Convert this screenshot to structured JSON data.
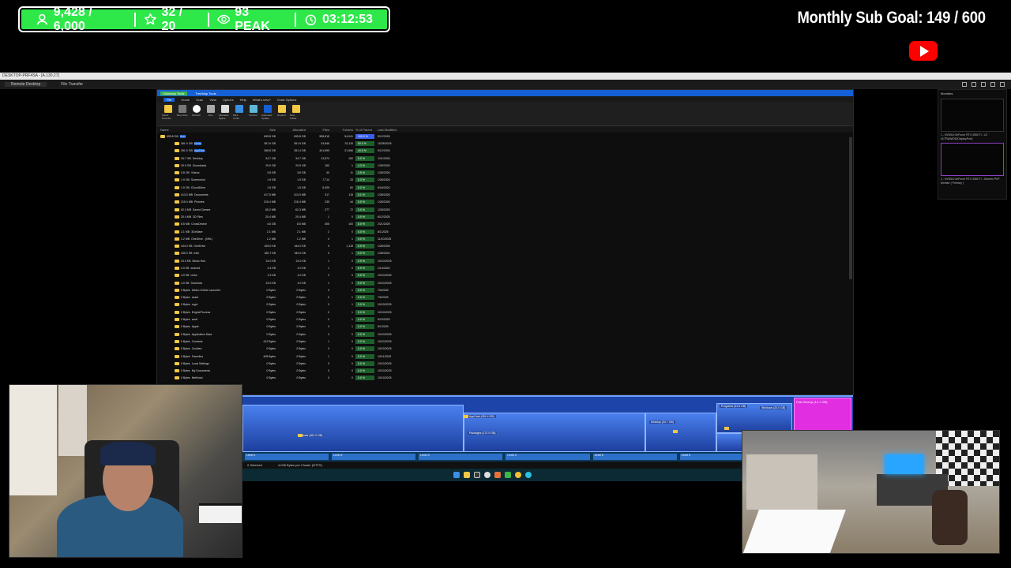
{
  "overlay": {
    "stats": [
      {
        "icon": "person-icon",
        "text": "9,428 / 6,000"
      },
      {
        "icon": "star-icon",
        "text": "32 / 20"
      },
      {
        "icon": "eye-icon",
        "text": "93 PEAK"
      },
      {
        "icon": "timer-icon",
        "text": "03:12:53"
      }
    ],
    "sub_goal": "Monthly Sub Goal:  149 / 600",
    "accent": "#2ee84a"
  },
  "remote_desktop": {
    "title": "DESKTOP-PRF4SA - [A.130.27]",
    "tabs": [
      "Remote Desktop",
      "File Transfer"
    ]
  },
  "app": {
    "title_tabs": [
      "Directory Tools",
      "TreeMap Tools"
    ],
    "ribbon_tabs": [
      "File",
      "Home",
      "Scan",
      "View",
      "Options",
      "Help",
      "What's new?",
      "Chart Options"
    ],
    "ribbon_buttons": [
      "Select Drive/Dir",
      "Stop Scan",
      "Refresh",
      "Size",
      "Allocated Space",
      "Files Count",
      "Percent",
      "Automatic Update",
      "Expand",
      "New Folder"
    ],
    "ribbon_groups": [
      "Scan",
      "Mode",
      "View",
      "Folder Operations"
    ],
    "columns": [
      "Name",
      "Size",
      "Allocated",
      "Files",
      "Folders",
      "% of Parent",
      "Last Modified"
    ],
    "rows": [
      {
        "size_tag": "695.8 GB",
        "name": "User",
        "size": "695.8 GB",
        "alloc": "695.8 GB",
        "files": "508,815",
        "folders": "54,041",
        "pct": "100.0 %",
        "date": "9/12/2026"
      },
      {
        "size_tag": "361.9 GB",
        "name": "Movie",
        "size": "361.9 GB",
        "alloc": "361.9 GB",
        "files": "34,846",
        "folders": "32,116",
        "pct": "52.0 %",
        "date": "10/28/2026"
      },
      {
        "size_tag": "281.5 GB",
        "name": "AppData",
        "size": "268.8 GB",
        "alloc": "281.4 GB",
        "files": "441,899",
        "folders": "21,566",
        "pct": "40.5 %",
        "date": "9/12/2026"
      },
      {
        "size_tag": "34.7 GB",
        "name": "Desktop",
        "size": "34.7 GB",
        "alloc": "34.7 GB",
        "files": "12,874",
        "folders": "150",
        "pct": "5.0 %",
        "date": "1/31/2026"
      },
      {
        "size_tag": "29.9 GB",
        "name": "Downloads",
        "size": "29.9 GB",
        "alloc": "29.9 GB",
        "files": "160",
        "folders": "1",
        "pct": "4.3 %",
        "date": "1/28/2026"
      },
      {
        "size_tag": "3.8 GB",
        "name": "Videos",
        "size": "3.8 GB",
        "alloc": "3.8 GB",
        "files": "40",
        "folders": "11",
        "pct": "0.5 %",
        "date": "1/28/2026"
      },
      {
        "size_tag": "1.9 GB",
        "name": "Screenshot",
        "size": "1.9 GB",
        "alloc": "1.9 GB",
        "files": "7,714",
        "folders": "33",
        "pct": "0.3 %",
        "date": "1/28/2026"
      },
      {
        "size_tag": "1.5 GB",
        "name": "iCloudDrive",
        "size": "1.5 GB",
        "alloc": "1.5 GB",
        "files": "5,309",
        "folders": "60",
        "pct": "0.2 %",
        "date": "6/16/2024"
      },
      {
        "size_tag": "413.0 MB",
        "name": "Documents",
        "size": "417.5 MB",
        "alloc": "413.0 MB",
        "files": "317",
        "folders": "115",
        "pct": "0.1 %",
        "date": "1/28/2026"
      },
      {
        "size_tag": "215.4 MB",
        "name": "Pictures",
        "size": "215.4 MB",
        "alloc": "215.4 MB",
        "files": "235",
        "folders": "44",
        "pct": "0.0 %",
        "date": "1/28/2026"
      },
      {
        "size_tag": "62.3 MB",
        "name": "Saved Games",
        "size": "65.2 MB",
        "alloc": "62.3 MB",
        "files": "277",
        "folders": "72",
        "pct": "0.0 %",
        "date": "12/8/2025"
      },
      {
        "size_tag": "20.4 MB",
        "name": "3D Files",
        "size": "20.4 MB",
        "alloc": "20.4 MB",
        "files": "1",
        "folders": "0",
        "pct": "0.0 %",
        "date": "6/12/2025"
      },
      {
        "size_tag": "8.5 MB",
        "name": "CrossDevice",
        "size": "4.6 GB",
        "alloc": "8.5 MB",
        "files": "305",
        "folders": "100",
        "pct": "0.0 %",
        "date": "2/21/2025"
      },
      {
        "size_tag": "2.1 MB",
        "name": "3DxWare",
        "size": "2.1 MB",
        "alloc": "2.1 MB",
        "files": "2",
        "folders": "0",
        "pct": "0.0 %",
        "date": "8/1/2025"
      },
      {
        "size_tag": "1.2 MB",
        "name": "OneDrive - (NHL)",
        "size": "1.2 MB",
        "alloc": "1.2 MB",
        "files": "4",
        "folders": "1",
        "pct": "0.0 %",
        "date": "11/10/2025"
      },
      {
        "size_tag": "444.0 KB",
        "name": "OneDrive",
        "size": "425.0 KB",
        "alloc": "444.0 KB",
        "files": "9",
        "folders": "1,115",
        "pct": "0.0 %",
        "date": "1/28/2026"
      },
      {
        "size_tag": "340.0 KB",
        "name": "Intel",
        "size": "330.7 KB",
        "alloc": "340.0 KB",
        "files": "3",
        "folders": "1",
        "pct": "0.0 %",
        "date": "1/28/2024"
      },
      {
        "size_tag": "24.0 KB",
        "name": "Music Hub",
        "size": "24.0 KB",
        "alloc": "24.0 KB",
        "files": "1",
        "folders": "0",
        "pct": "0.0 %",
        "date": "10/10/2025"
      },
      {
        "size_tag": "4.0 KB",
        "name": "android",
        "size": "2.4 KB",
        "alloc": "4.0 KB",
        "files": "1",
        "folders": "0",
        "pct": "0.0 %",
        "date": "1/14/2024"
      },
      {
        "size_tag": "4.0 KB",
        "name": "Links",
        "size": "1.9 KB",
        "alloc": "4.0 KB",
        "files": "2",
        "folders": "0",
        "pct": "0.0 %",
        "date": "10/10/2025"
      },
      {
        "size_tag": "4.0 KB",
        "name": "Searches",
        "size": "24.0 KB",
        "alloc": "4.0 KB",
        "files": "1",
        "folders": "0",
        "pct": "0.0 %",
        "date": "10/10/2025"
      },
      {
        "size_tag": "0 Bytes",
        "name": "Albion Online Launcher",
        "size": "0 Bytes",
        "alloc": "0 Bytes",
        "files": "0",
        "folders": "1",
        "pct": "0.0 %",
        "date": "7/6/2025"
      },
      {
        "size_tag": "0 Bytes",
        "name": "ansel",
        "size": "0 Bytes",
        "alloc": "0 Bytes",
        "files": "0",
        "folders": "1",
        "pct": "0.0 %",
        "date": "7/6/2025"
      },
      {
        "size_tag": "0 Bytes",
        "name": "crypt",
        "size": "0 Bytes",
        "alloc": "0 Bytes",
        "files": "0",
        "folders": "1",
        "pct": "0.0 %",
        "date": "10/10/2025"
      },
      {
        "size_tag": "0 Bytes",
        "name": "EngineProcess",
        "size": "0 Bytes",
        "alloc": "0 Bytes",
        "files": "0",
        "folders": "1",
        "pct": "0.0 %",
        "date": "10/10/2025"
      },
      {
        "size_tag": "0 Bytes",
        "name": "anvil",
        "size": "0 Bytes",
        "alloc": "0 Bytes",
        "files": "0",
        "folders": "1",
        "pct": "0.0 %",
        "date": "5/15/2025"
      },
      {
        "size_tag": "0 Bytes",
        "name": "Apple",
        "size": "0 Bytes",
        "alloc": "0 Bytes",
        "files": "0",
        "folders": "1",
        "pct": "0.0 %",
        "date": "5/1/2025"
      },
      {
        "size_tag": "0 Bytes",
        "name": "Application Data",
        "size": "0 Bytes",
        "alloc": "0 Bytes",
        "files": "0",
        "folders": "0",
        "pct": "0.0 %",
        "date": "10/10/2025"
      },
      {
        "size_tag": "0 Bytes",
        "name": "Contacts",
        "size": "412 Bytes",
        "alloc": "0 Bytes",
        "files": "1",
        "folders": "0",
        "pct": "0.0 %",
        "date": "10/10/2025"
      },
      {
        "size_tag": "0 Bytes",
        "name": "Cookies",
        "size": "0 Bytes",
        "alloc": "0 Bytes",
        "files": "0",
        "folders": "0",
        "pct": "0.0 %",
        "date": "10/10/2025"
      },
      {
        "size_tag": "0 Bytes",
        "name": "Favorites",
        "size": "408 Bytes",
        "alloc": "0 Bytes",
        "files": "1",
        "folders": "0",
        "pct": "0.0 %",
        "date": "10/11/2025"
      },
      {
        "size_tag": "0 Bytes",
        "name": "Local Settings",
        "size": "0 Bytes",
        "alloc": "0 Bytes",
        "files": "0",
        "folders": "0",
        "pct": "0.0 %",
        "date": "10/10/2025"
      },
      {
        "size_tag": "0 Bytes",
        "name": "My Documents",
        "size": "0 Bytes",
        "alloc": "0 Bytes",
        "files": "0",
        "folders": "0",
        "pct": "0.0 %",
        "date": "10/10/2025"
      },
      {
        "size_tag": "0 Bytes",
        "name": "NetHood",
        "size": "0 Bytes",
        "alloc": "0 Bytes",
        "files": "0",
        "folders": "0",
        "pct": "0.0 %",
        "date": "10/10/2025"
      }
    ],
    "treemap_labels": [
      "AppData (281.4 GB)",
      "Movie (361.9 GB)",
      "Packages (172.0 GB)",
      "Desktop (34.7 GB)",
      "Programs (34.6 GB)",
      "Windows (20.0 GB)",
      "Fast Sweep (14.1 GB)"
    ],
    "status_segments": [
      "Level 1",
      "Level 2",
      "Level 3",
      "Level 4",
      "Level 5",
      "Level 6",
      "Level 7"
    ],
    "info": [
      "0 Selected",
      "4,096 Bytes per Cluster (NTFS)"
    ]
  },
  "monitors_panel": {
    "title": "Monitors",
    "labels": [
      "1 - NVIDIA GeForce RTX 3080 Ti - LG ULTRAWIDE(DisplayPort)",
      "2 - NVIDIA GeForce RTX 3080 Ti - Generic PnP Monitor ( Primary )"
    ]
  }
}
